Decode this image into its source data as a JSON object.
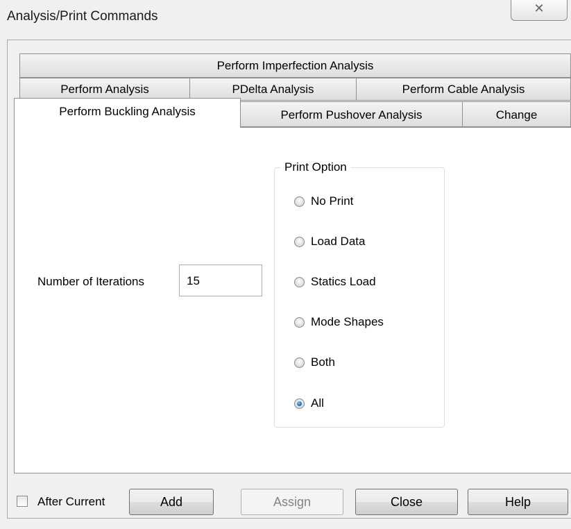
{
  "window": {
    "title": "Analysis/Print Commands",
    "close_glyph": "✕"
  },
  "tabs": {
    "row1": [
      "Perform Imperfection Analysis"
    ],
    "row2": [
      "Perform Analysis",
      "PDelta Analysis",
      "Perform Cable Analysis"
    ],
    "row3": [
      "Perform Buckling Analysis",
      "Perform Pushover Analysis",
      "Change"
    ],
    "active": "Perform Buckling Analysis"
  },
  "panel": {
    "iterations_label": "Number of Iterations",
    "iterations_value": "15",
    "print_option": {
      "title": "Print Option",
      "options": [
        "No Print",
        "Load Data",
        "Statics Load",
        "Mode Shapes",
        "Both",
        "All"
      ],
      "selected": "All"
    }
  },
  "footer": {
    "after_current_label": "After Current",
    "after_current_checked": false,
    "add_label": "Add",
    "assign_label": "Assign",
    "close_label": "Close",
    "help_label": "Help"
  }
}
